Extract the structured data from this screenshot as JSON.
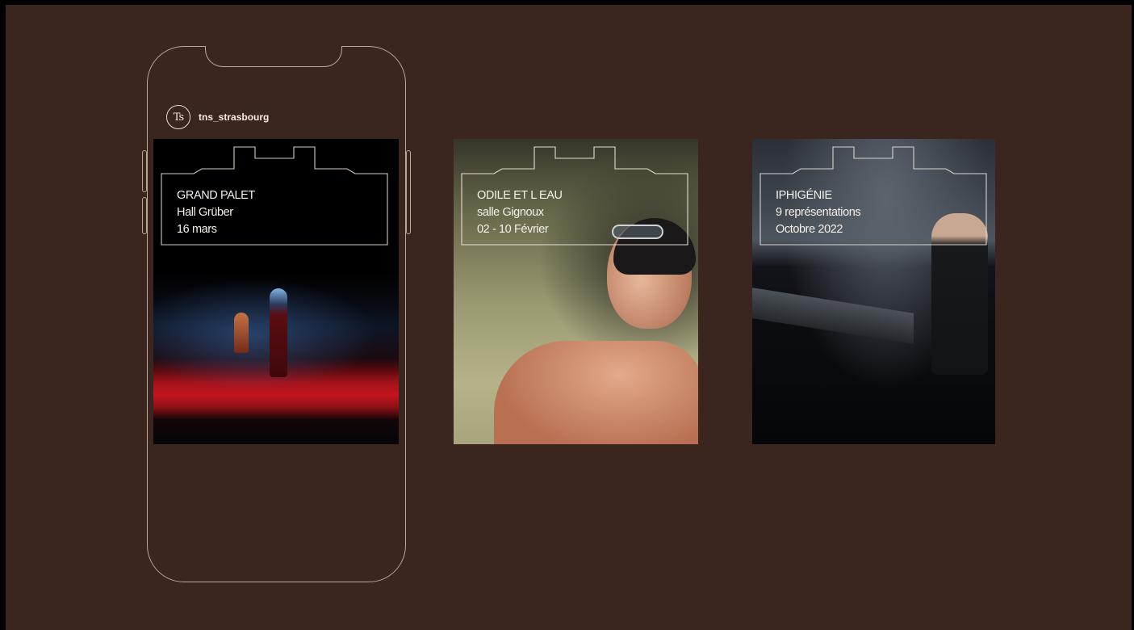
{
  "account": {
    "avatar_text": "Ts",
    "handle": "tns_strasbourg"
  },
  "posters": [
    {
      "title": "GRAND PALET",
      "venue": "Hall Grüber",
      "date": "16 mars"
    },
    {
      "title": "ODILE ET L EAU",
      "venue": "salle Gignoux",
      "date": "02 - 10 Février"
    },
    {
      "title": "IPHIGÉNIE",
      "venue": "9 représentations",
      "date": "Octobre 2022"
    }
  ],
  "colors": {
    "background": "#3a261e",
    "outline": "#b9a79c",
    "text": "#f6f0ea"
  }
}
